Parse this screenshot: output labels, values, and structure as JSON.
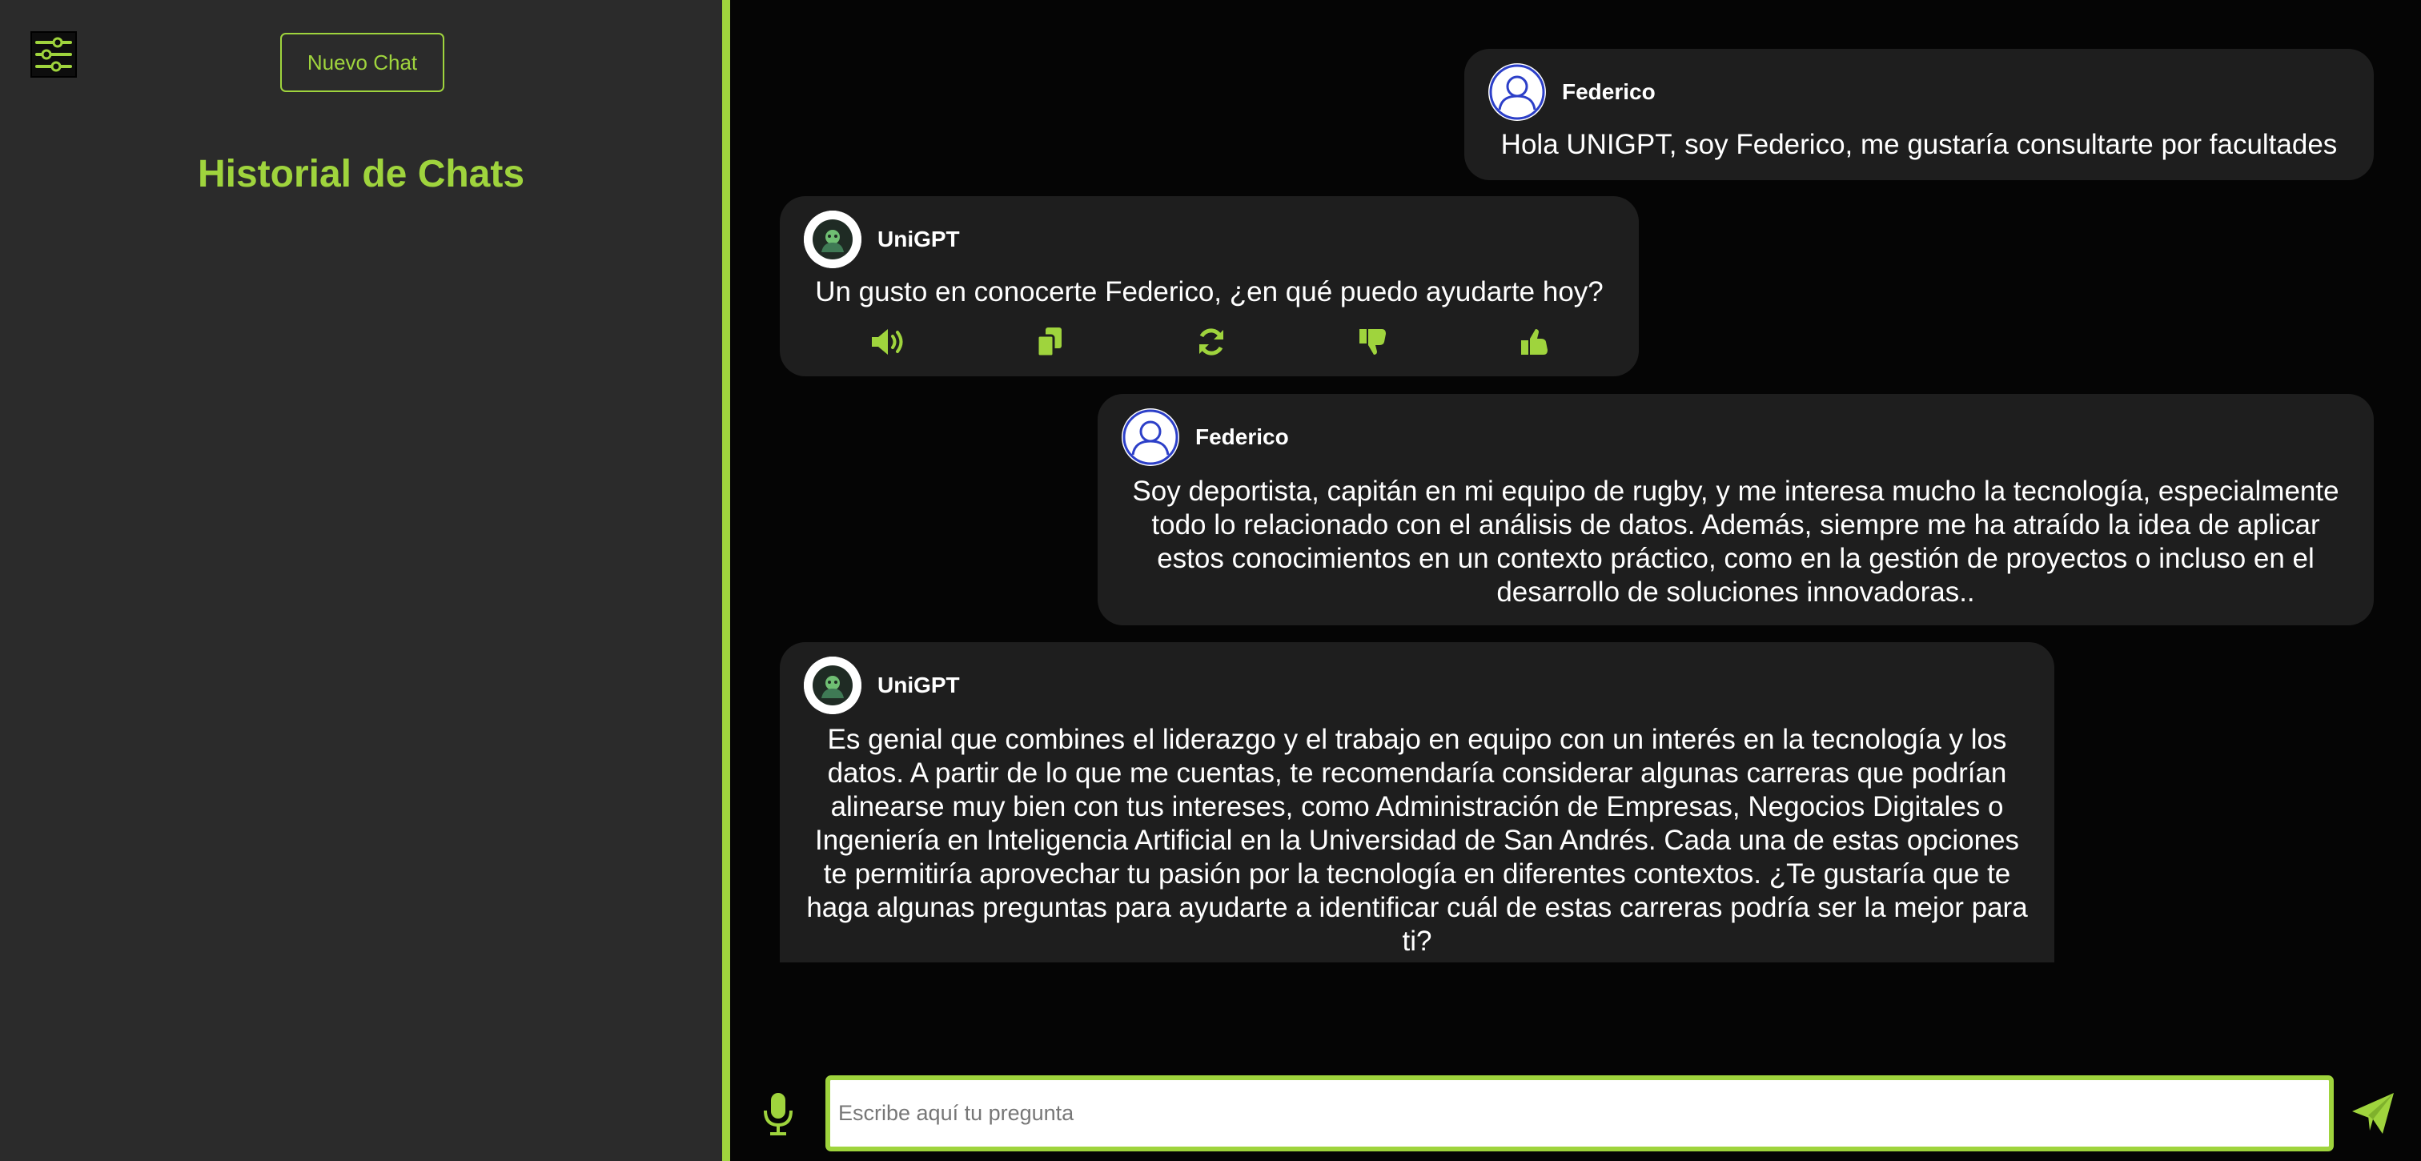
{
  "sidebar": {
    "menu_icon": "sliders-icon",
    "new_chat_label": "Nuevo Chat",
    "history_title": "Historial de Chats"
  },
  "messages": [
    {
      "sender": "Federico",
      "role": "user",
      "avatar_icon": "user-avatar-icon",
      "text": "Hola UNIGPT, soy Federico, me gustaría consultarte por facultades"
    },
    {
      "sender": "UniGPT",
      "role": "assistant",
      "avatar_icon": "bot-avatar-icon",
      "text": "Un gusto en conocerte Federico, ¿en qué puedo ayudarte hoy?",
      "actions": [
        "speaker-icon",
        "copy-icon",
        "refresh-icon",
        "thumbs-down-icon",
        "thumbs-up-icon"
      ]
    },
    {
      "sender": "Federico",
      "role": "user",
      "avatar_icon": "user-avatar-icon",
      "text": "Soy deportista, capitán en mi equipo de rugby, y me interesa mucho la tecnología, especialmente todo lo relacionado con el análisis de datos. Además, siempre me ha atraído la idea de aplicar estos conocimientos en un contexto práctico, como en la gestión de proyectos o incluso en el desarrollo de soluciones innovadoras.."
    },
    {
      "sender": "UniGPT",
      "role": "assistant",
      "avatar_icon": "bot-avatar-icon",
      "text": "Es genial que combines el liderazgo y el trabajo en equipo con un interés en la tecnología y los datos. A partir de lo que me cuentas, te recomendaría considerar algunas carreras que podrían alinearse muy bien con tus intereses, como Administración de Empresas, Negocios Digitales o Ingeniería en Inteligencia Artificial en la Universidad de San Andrés. Cada una de estas opciones te permitiría aprovechar tu pasión por la tecnología en diferentes contextos. ¿Te gustaría que te haga algunas preguntas para ayudarte a identificar cuál de estas carreras podría ser la mejor para ti?"
    }
  ],
  "input": {
    "placeholder": "Escribe aquí tu pregunta",
    "value": "",
    "mic_icon": "microphone-icon",
    "send_icon": "send-icon"
  },
  "colors": {
    "accent": "#9fd43d",
    "sidebar_bg": "#2b2b2b",
    "chat_bg": "#050505",
    "bubble_bg": "#1e1e1e",
    "user_avatar_ring": "#2c3fc8"
  }
}
